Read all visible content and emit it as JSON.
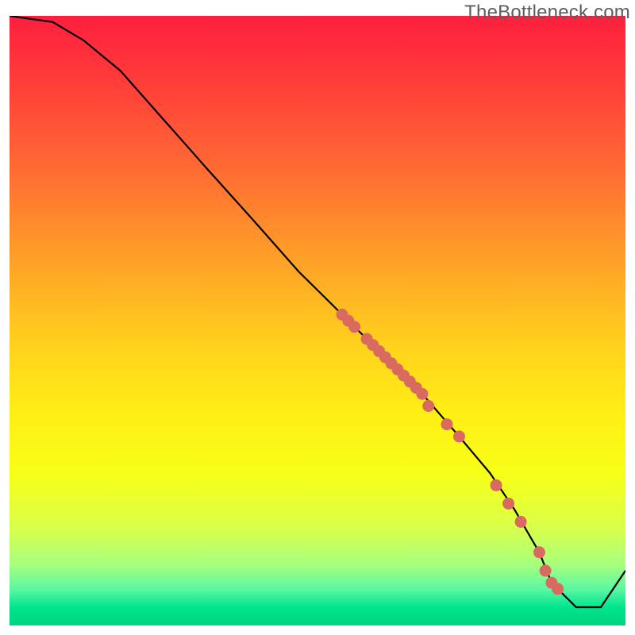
{
  "watermark": "TheBottleneck.com",
  "chart_data": {
    "type": "line",
    "title": "",
    "xlabel": "",
    "ylabel": "",
    "xlim": [
      0,
      100
    ],
    "ylim": [
      0,
      100
    ],
    "grid": false,
    "legend": false,
    "line": {
      "x": [
        0,
        7,
        12,
        18,
        25,
        32,
        40,
        47,
        55,
        61,
        67,
        73,
        78,
        82,
        86,
        88,
        92,
        96,
        100
      ],
      "y": [
        100,
        99,
        96,
        91,
        83,
        75,
        66,
        58,
        50,
        44,
        38,
        31,
        25,
        19,
        12,
        7,
        3,
        3,
        9
      ]
    },
    "markers": {
      "x": [
        54,
        55,
        56,
        58,
        59,
        60,
        61,
        62,
        63,
        64,
        65,
        66,
        67,
        68,
        71,
        73,
        79,
        81,
        83,
        86,
        87,
        88,
        89
      ],
      "y": [
        51,
        50,
        49,
        47,
        46,
        45,
        44,
        43,
        42,
        41,
        40,
        39,
        38,
        36,
        33,
        31,
        23,
        20,
        17,
        12,
        9,
        7,
        6
      ]
    },
    "background_gradient": {
      "stops": [
        {
          "pos": 0,
          "color": "#ff1f3e"
        },
        {
          "pos": 25,
          "color": "#ff6a33"
        },
        {
          "pos": 55,
          "color": "#ffd41c"
        },
        {
          "pos": 75,
          "color": "#f7ff17"
        },
        {
          "pos": 94,
          "color": "#5cf7a3"
        },
        {
          "pos": 100,
          "color": "#00d47e"
        }
      ]
    }
  }
}
